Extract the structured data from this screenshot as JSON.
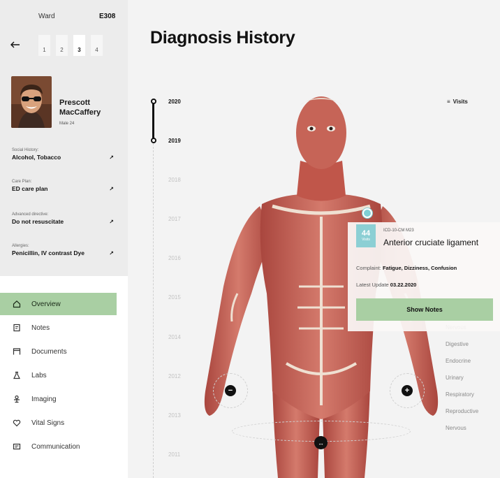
{
  "ward": {
    "label": "Ward",
    "code": "E308",
    "floors": [
      "1",
      "2",
      "3",
      "4"
    ],
    "active_floor": "3"
  },
  "patient": {
    "name": "Prescott MacCaffery",
    "meta": "Male 24",
    "info": [
      {
        "label": "Social History:",
        "value": "Alcohol, Tobacco"
      },
      {
        "label": "Care Plan:",
        "value": "ED care plan"
      },
      {
        "label": "Advanced directive:",
        "value": "Do not resuscitate"
      },
      {
        "label": "Allergies:",
        "value": "Penicillin, IV contrast Dye"
      }
    ]
  },
  "nav": {
    "items": [
      {
        "label": "Overview",
        "icon": "home-icon",
        "active": true
      },
      {
        "label": "Notes",
        "icon": "notes-icon",
        "active": false
      },
      {
        "label": "Documents",
        "icon": "documents-icon",
        "active": false
      },
      {
        "label": "Labs",
        "icon": "labs-icon",
        "active": false
      },
      {
        "label": "Imaging",
        "icon": "imaging-icon",
        "active": false
      },
      {
        "label": "Vital Signs",
        "icon": "heart-icon",
        "active": false
      },
      {
        "label": "Communication",
        "icon": "chat-icon",
        "active": false
      }
    ]
  },
  "page": {
    "title": "Diagnosis History"
  },
  "timeline": {
    "years": [
      "2020",
      "2019",
      "2018",
      "2017",
      "2016",
      "2015",
      "2014",
      "2012",
      "2013",
      "2011"
    ]
  },
  "filter": {
    "label": "Visits"
  },
  "systems": [
    "Nervous",
    "Digestive",
    "Endocrine",
    "Urinary",
    "Respiratory",
    "Reproductive",
    "Nervous"
  ],
  "diagnosis_card": {
    "visits": "44",
    "visits_label": "Visits",
    "code": "ICD-10-CM M23",
    "title": "Anterior cruciate ligament",
    "complaint_label": "Complaint:",
    "complaint_value": "Fatigue, Dizziness, Confusion",
    "update_label": "Latest Update",
    "update_value": "03.22.2020",
    "button": "Show Notes"
  },
  "colors": {
    "accent_green": "#a9cfa3",
    "accent_teal": "#8ccfd4",
    "muscle": "#c65c52"
  }
}
